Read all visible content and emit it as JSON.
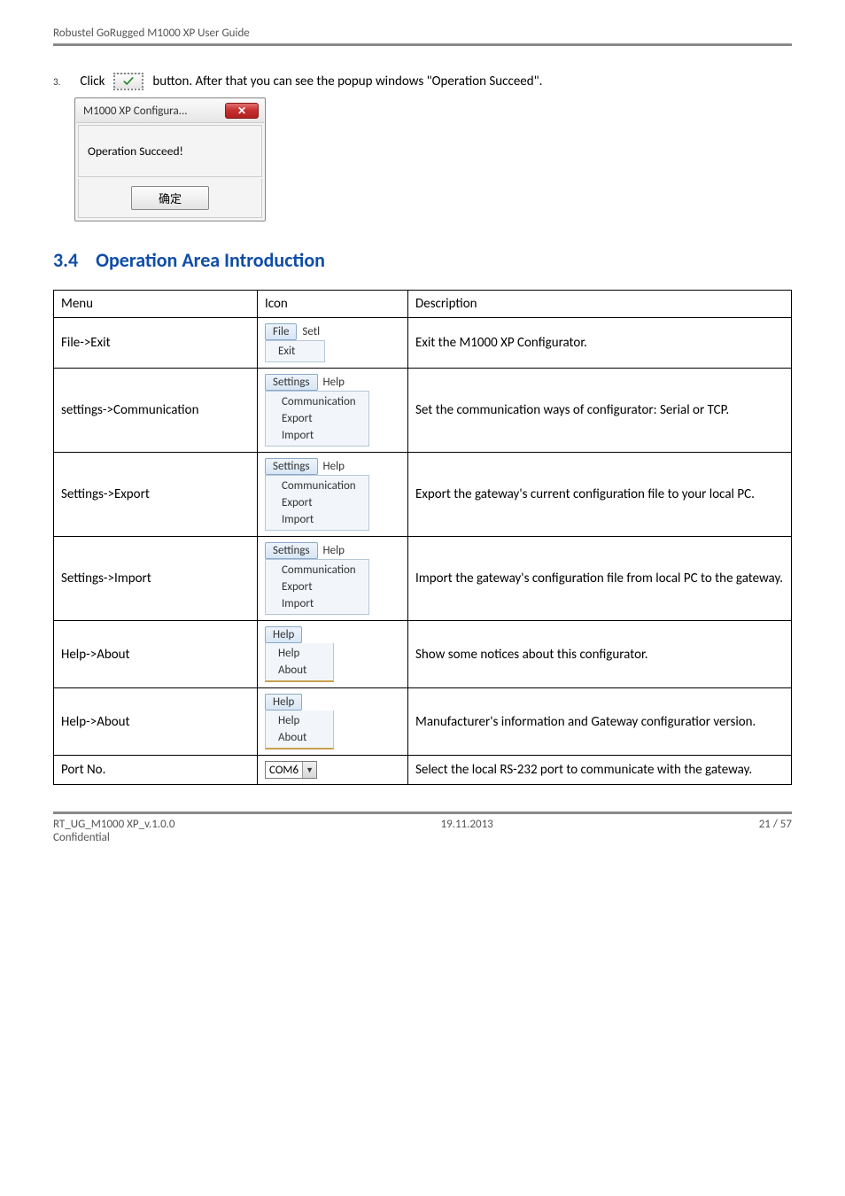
{
  "header": {
    "title": "Robustel GoRugged M1000 XP User Guide"
  },
  "step": {
    "number": "3.",
    "prefix": "Click",
    "suffix": "button. After that you can see the popup windows \"Operation Succeed\"."
  },
  "dialog": {
    "title": "M1000 XP Configura...",
    "body": "Operation Succeed!",
    "ok": "确定"
  },
  "section": {
    "number": "3.4",
    "title": "Operation Area Introduction"
  },
  "table": {
    "headers": {
      "menu": "Menu",
      "icon": "Icon",
      "description": "Description"
    },
    "rows": [
      {
        "menu": "File->Exit",
        "icon": {
          "type": "file_exit",
          "top": [
            "File",
            "Setl"
          ],
          "items": [
            "Exit"
          ]
        },
        "desc": "Exit the M1000 XP Configurator."
      },
      {
        "menu": "settings->Communication",
        "icon": {
          "type": "settings_menu",
          "top": [
            "Settings",
            "Help"
          ],
          "items": [
            "Communication",
            "Export",
            "Import"
          ]
        },
        "desc": "Set the communication ways of configurator: Serial or TCP."
      },
      {
        "menu": "Settings->Export",
        "icon": {
          "type": "settings_menu",
          "top": [
            "Settings",
            "Help"
          ],
          "items": [
            "Communication",
            "Export",
            "Import"
          ]
        },
        "desc": "Export the gateway's current configuration file to your local PC."
      },
      {
        "menu": "Settings->Import",
        "icon": {
          "type": "settings_menu",
          "top": [
            "Settings",
            "Help"
          ],
          "items": [
            "Communication",
            "Export",
            "Import"
          ]
        },
        "desc": "Import the gateway's configuration file from local PC to the gateway."
      },
      {
        "menu": "Help->About",
        "icon": {
          "type": "help_menu",
          "top": [
            "Help"
          ],
          "items": [
            "Help",
            "About"
          ]
        },
        "desc": "Show some notices about this configurator."
      },
      {
        "menu": "Help->About",
        "icon": {
          "type": "help_menu",
          "top": [
            "Help"
          ],
          "items": [
            "Help",
            "About"
          ]
        },
        "desc": "Manufacturer's information and Gateway configuratior version."
      },
      {
        "menu": "Port No.",
        "icon": {
          "type": "combo",
          "value": "COM6"
        },
        "desc": "Select the local RS-232 port to communicate with the gateway."
      }
    ]
  },
  "footer": {
    "left1": "RT_UG_M1000 XP_v.1.0.0",
    "left2": "Confidential",
    "center": "19.11.2013",
    "right": "21 / 57"
  }
}
